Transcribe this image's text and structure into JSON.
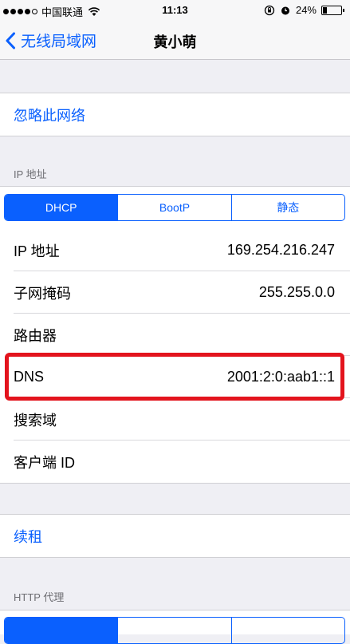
{
  "status_bar": {
    "carrier": "中国联通",
    "time": "11:13",
    "battery": "24%",
    "battery_level": 0.24,
    "signal_bars": 4,
    "signal_max": 5
  },
  "nav": {
    "back_label": "无线局域网",
    "title": "黄小萌"
  },
  "forget_network": "忽略此网络",
  "ip_section": {
    "header": "IP 地址",
    "segments": [
      "DHCP",
      "BootP",
      "静态"
    ],
    "selected": "DHCP",
    "rows": [
      {
        "label": "IP 地址",
        "value": "169.254.216.247"
      },
      {
        "label": "子网掩码",
        "value": "255.255.0.0"
      },
      {
        "label": "路由器",
        "value": ""
      },
      {
        "label": "DNS",
        "value": "2001:2:0:aab1::1"
      },
      {
        "label": "搜索域",
        "value": ""
      },
      {
        "label": "客户端 ID",
        "value": ""
      }
    ]
  },
  "renew_lease": "续租",
  "http_proxy": {
    "header": "HTTP 代理"
  },
  "colors": {
    "accent": "#0a60fe",
    "highlight": "#e3141d",
    "background": "#efeff4"
  }
}
